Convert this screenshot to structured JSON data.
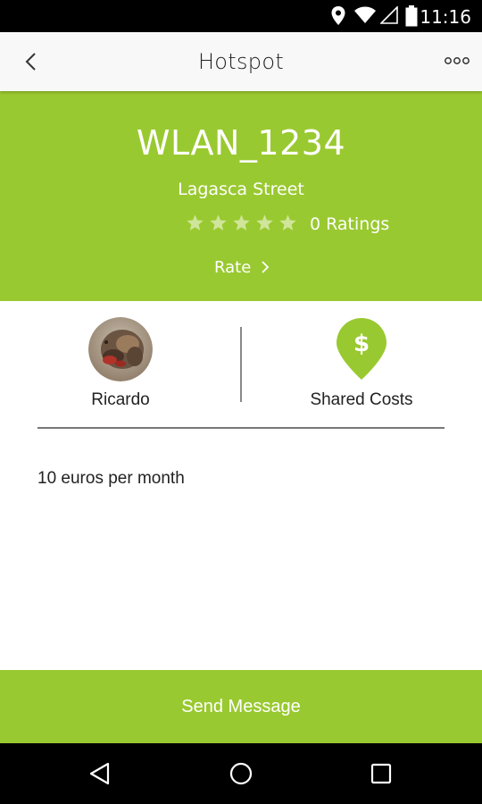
{
  "status_bar": {
    "time": "11:16",
    "icons": [
      "location-icon",
      "wifi-icon",
      "signal-icon",
      "battery-icon"
    ]
  },
  "app_bar": {
    "title": "Hotspot",
    "back_icon": "chevron-left-icon",
    "more_icon": "more-dots-icon"
  },
  "header": {
    "ssid": "WLAN_1234",
    "street": "Lagasca Street",
    "rating_stars": 0,
    "max_stars": 5,
    "ratings_text": "0 Ratings",
    "rate_label": "Rate",
    "background_color": "#99c930"
  },
  "owner": {
    "name": "Ricardo",
    "avatar_icon": "user-avatar"
  },
  "cost": {
    "label": "Shared Costs",
    "icon": "dollar-pin-icon"
  },
  "description": "10 euros per month",
  "send_button": {
    "label": "Send Message"
  },
  "nav_bar": {
    "icons": [
      "back-triangle-icon",
      "home-circle-icon",
      "recents-square-icon"
    ]
  }
}
